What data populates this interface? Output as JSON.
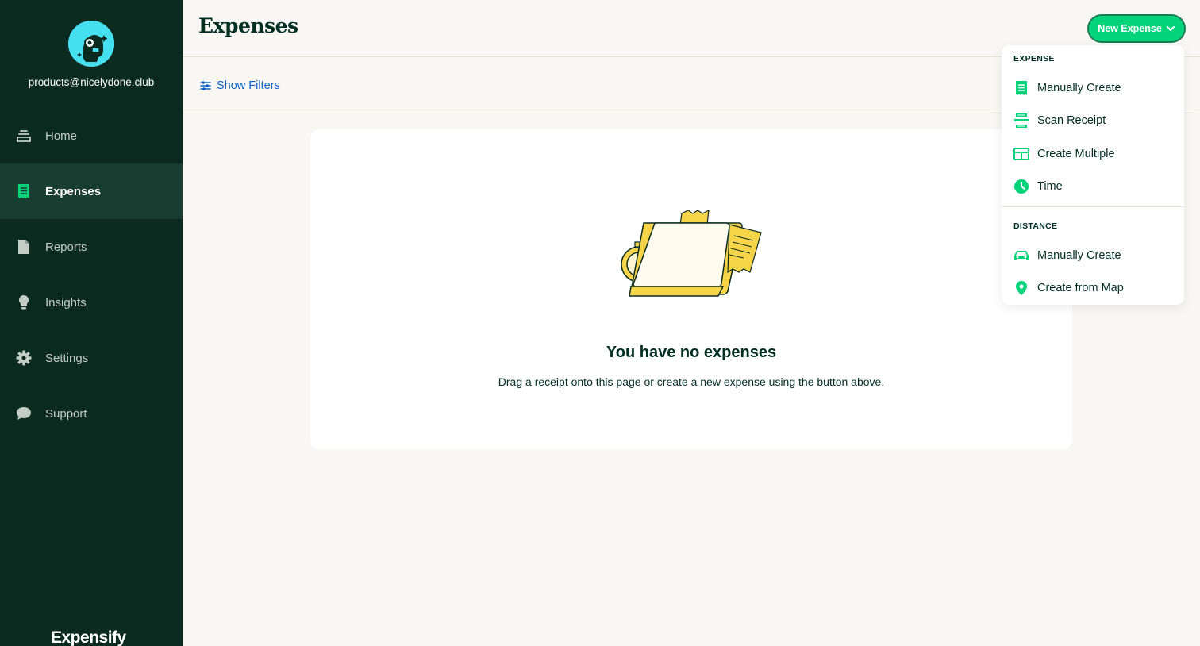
{
  "user": {
    "email": "products@nicelydone.club"
  },
  "sidebar": {
    "items": [
      {
        "label": "Home",
        "icon": "home-icon"
      },
      {
        "label": "Expenses",
        "icon": "receipt-icon",
        "active": true
      },
      {
        "label": "Reports",
        "icon": "document-icon"
      },
      {
        "label": "Insights",
        "icon": "lightbulb-icon"
      },
      {
        "label": "Settings",
        "icon": "gear-icon"
      },
      {
        "label": "Support",
        "icon": "chat-bubble-icon"
      }
    ],
    "brand": "Expensify"
  },
  "header": {
    "title": "Expenses",
    "new_expense_label": "New Expense"
  },
  "filters": {
    "show_label": "Show Filters"
  },
  "empty_state": {
    "title": "You have no expenses",
    "subtitle": "Drag a receipt onto this page or create a new expense using the button above."
  },
  "dropdown": {
    "sections": [
      {
        "label": "EXPENSE",
        "items": [
          {
            "label": "Manually Create",
            "icon": "receipt-icon"
          },
          {
            "label": "Scan Receipt",
            "icon": "scan-receipt-icon"
          },
          {
            "label": "Create Multiple",
            "icon": "table-icon"
          },
          {
            "label": "Time",
            "icon": "clock-icon"
          }
        ]
      },
      {
        "label": "DISTANCE",
        "items": [
          {
            "label": "Manually Create",
            "icon": "car-icon"
          },
          {
            "label": "Create from Map",
            "icon": "map-pin-icon"
          }
        ]
      }
    ]
  },
  "colors": {
    "sidebar_bg": "#0b2a20",
    "sidebar_active": "#1a3d31",
    "accent_green": "#03d47c",
    "link_blue": "#0b61c7",
    "page_bg": "#f8f7f3"
  }
}
